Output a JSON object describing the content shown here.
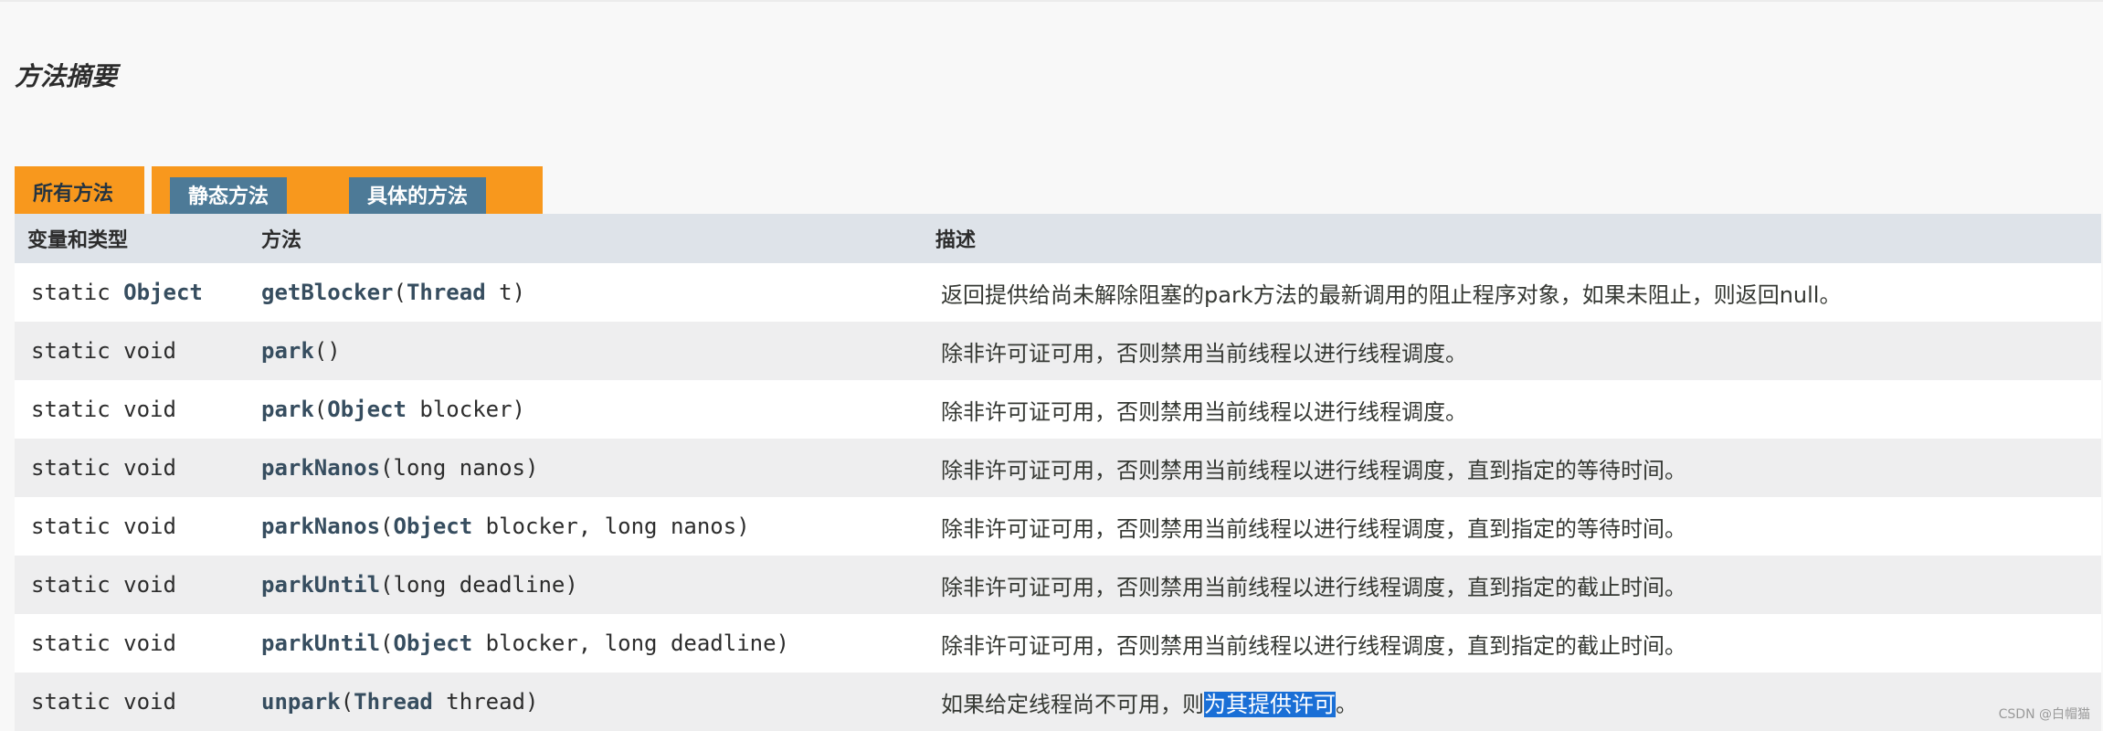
{
  "section_title": "方法摘要",
  "tabs": [
    {
      "label": "所有方法",
      "active": true
    },
    {
      "label": "静态方法",
      "active": false
    },
    {
      "label": "具体的方法",
      "active": false
    }
  ],
  "columns": [
    "变量和类型",
    "方法",
    "描述"
  ],
  "rows": [
    {
      "mod": "static",
      "type": "Object",
      "name": "getBlocker",
      "p1type": "Thread",
      "params": " t",
      "desc": "返回提供给尚未解除阻塞的park方法的最新调用的阻止程序对象，如果未阻止，则返回null。"
    },
    {
      "mod": "static",
      "type": "void",
      "name": "park",
      "p1type": "",
      "params": "",
      "desc": "除非许可证可用，否则禁用当前线程以进行线程调度。"
    },
    {
      "mod": "static",
      "type": "void",
      "name": "park",
      "p1type": "Object",
      "params": " blocker",
      "desc": "除非许可证可用，否则禁用当前线程以进行线程调度。"
    },
    {
      "mod": "static",
      "type": "void",
      "name": "parkNanos",
      "p1type": "",
      "params": "long nanos",
      "desc": "除非许可证可用，否则禁用当前线程以进行线程调度，直到指定的等待时间。"
    },
    {
      "mod": "static",
      "type": "void",
      "name": "parkNanos",
      "p1type": "Object",
      "params": " blocker, long nanos",
      "desc": "除非许可证可用，否则禁用当前线程以进行线程调度，直到指定的等待时间。"
    },
    {
      "mod": "static",
      "type": "void",
      "name": "parkUntil",
      "p1type": "",
      "params": "long deadline",
      "desc": "除非许可证可用，否则禁用当前线程以进行线程调度，直到指定的截止时间。"
    },
    {
      "mod": "static",
      "type": "void",
      "name": "parkUntil",
      "p1type": "Object",
      "params": " blocker, long deadline",
      "desc": "除非许可证可用，否则禁用当前线程以进行线程调度，直到指定的截止时间。"
    },
    {
      "mod": "static",
      "type": "void",
      "name": "unpark",
      "p1type": "Thread",
      "params": " thread",
      "desc_pre": "如果给定线程尚不可用，则",
      "desc_sel": "为其提供许可",
      "desc_post": "。"
    }
  ],
  "watermark": "CSDN @白帽猫",
  "colors": {
    "tab_active": "#f8981d",
    "tab_inactive": "#4d7a97",
    "header_bg": "#dee3e9",
    "alt_row": "#eeeeef",
    "selection": "#1a6fd6"
  }
}
